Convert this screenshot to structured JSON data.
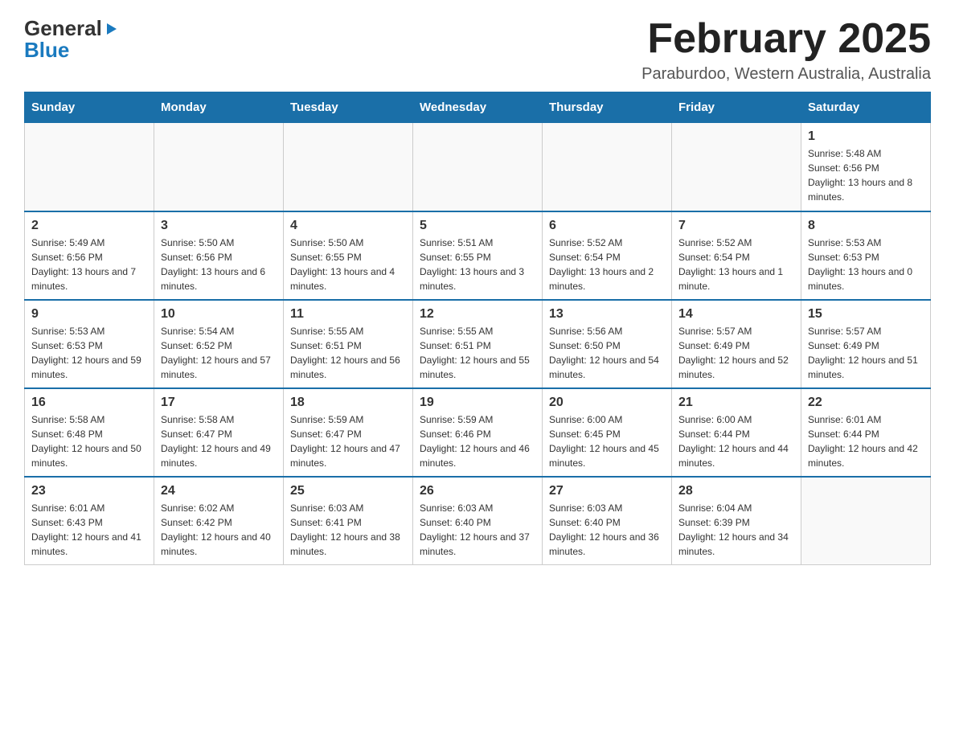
{
  "logo": {
    "line1": "General",
    "triangle": "▶",
    "line2": "Blue"
  },
  "title": "February 2025",
  "location": "Paraburdoo, Western Australia, Australia",
  "weekdays": [
    "Sunday",
    "Monday",
    "Tuesday",
    "Wednesday",
    "Thursday",
    "Friday",
    "Saturday"
  ],
  "weeks": [
    [
      null,
      null,
      null,
      null,
      null,
      null,
      {
        "day": "1",
        "sunrise": "Sunrise: 5:48 AM",
        "sunset": "Sunset: 6:56 PM",
        "daylight": "Daylight: 13 hours and 8 minutes."
      }
    ],
    [
      {
        "day": "2",
        "sunrise": "Sunrise: 5:49 AM",
        "sunset": "Sunset: 6:56 PM",
        "daylight": "Daylight: 13 hours and 7 minutes."
      },
      {
        "day": "3",
        "sunrise": "Sunrise: 5:50 AM",
        "sunset": "Sunset: 6:56 PM",
        "daylight": "Daylight: 13 hours and 6 minutes."
      },
      {
        "day": "4",
        "sunrise": "Sunrise: 5:50 AM",
        "sunset": "Sunset: 6:55 PM",
        "daylight": "Daylight: 13 hours and 4 minutes."
      },
      {
        "day": "5",
        "sunrise": "Sunrise: 5:51 AM",
        "sunset": "Sunset: 6:55 PM",
        "daylight": "Daylight: 13 hours and 3 minutes."
      },
      {
        "day": "6",
        "sunrise": "Sunrise: 5:52 AM",
        "sunset": "Sunset: 6:54 PM",
        "daylight": "Daylight: 13 hours and 2 minutes."
      },
      {
        "day": "7",
        "sunrise": "Sunrise: 5:52 AM",
        "sunset": "Sunset: 6:54 PM",
        "daylight": "Daylight: 13 hours and 1 minute."
      },
      {
        "day": "8",
        "sunrise": "Sunrise: 5:53 AM",
        "sunset": "Sunset: 6:53 PM",
        "daylight": "Daylight: 13 hours and 0 minutes."
      }
    ],
    [
      {
        "day": "9",
        "sunrise": "Sunrise: 5:53 AM",
        "sunset": "Sunset: 6:53 PM",
        "daylight": "Daylight: 12 hours and 59 minutes."
      },
      {
        "day": "10",
        "sunrise": "Sunrise: 5:54 AM",
        "sunset": "Sunset: 6:52 PM",
        "daylight": "Daylight: 12 hours and 57 minutes."
      },
      {
        "day": "11",
        "sunrise": "Sunrise: 5:55 AM",
        "sunset": "Sunset: 6:51 PM",
        "daylight": "Daylight: 12 hours and 56 minutes."
      },
      {
        "day": "12",
        "sunrise": "Sunrise: 5:55 AM",
        "sunset": "Sunset: 6:51 PM",
        "daylight": "Daylight: 12 hours and 55 minutes."
      },
      {
        "day": "13",
        "sunrise": "Sunrise: 5:56 AM",
        "sunset": "Sunset: 6:50 PM",
        "daylight": "Daylight: 12 hours and 54 minutes."
      },
      {
        "day": "14",
        "sunrise": "Sunrise: 5:57 AM",
        "sunset": "Sunset: 6:49 PM",
        "daylight": "Daylight: 12 hours and 52 minutes."
      },
      {
        "day": "15",
        "sunrise": "Sunrise: 5:57 AM",
        "sunset": "Sunset: 6:49 PM",
        "daylight": "Daylight: 12 hours and 51 minutes."
      }
    ],
    [
      {
        "day": "16",
        "sunrise": "Sunrise: 5:58 AM",
        "sunset": "Sunset: 6:48 PM",
        "daylight": "Daylight: 12 hours and 50 minutes."
      },
      {
        "day": "17",
        "sunrise": "Sunrise: 5:58 AM",
        "sunset": "Sunset: 6:47 PM",
        "daylight": "Daylight: 12 hours and 49 minutes."
      },
      {
        "day": "18",
        "sunrise": "Sunrise: 5:59 AM",
        "sunset": "Sunset: 6:47 PM",
        "daylight": "Daylight: 12 hours and 47 minutes."
      },
      {
        "day": "19",
        "sunrise": "Sunrise: 5:59 AM",
        "sunset": "Sunset: 6:46 PM",
        "daylight": "Daylight: 12 hours and 46 minutes."
      },
      {
        "day": "20",
        "sunrise": "Sunrise: 6:00 AM",
        "sunset": "Sunset: 6:45 PM",
        "daylight": "Daylight: 12 hours and 45 minutes."
      },
      {
        "day": "21",
        "sunrise": "Sunrise: 6:00 AM",
        "sunset": "Sunset: 6:44 PM",
        "daylight": "Daylight: 12 hours and 44 minutes."
      },
      {
        "day": "22",
        "sunrise": "Sunrise: 6:01 AM",
        "sunset": "Sunset: 6:44 PM",
        "daylight": "Daylight: 12 hours and 42 minutes."
      }
    ],
    [
      {
        "day": "23",
        "sunrise": "Sunrise: 6:01 AM",
        "sunset": "Sunset: 6:43 PM",
        "daylight": "Daylight: 12 hours and 41 minutes."
      },
      {
        "day": "24",
        "sunrise": "Sunrise: 6:02 AM",
        "sunset": "Sunset: 6:42 PM",
        "daylight": "Daylight: 12 hours and 40 minutes."
      },
      {
        "day": "25",
        "sunrise": "Sunrise: 6:03 AM",
        "sunset": "Sunset: 6:41 PM",
        "daylight": "Daylight: 12 hours and 38 minutes."
      },
      {
        "day": "26",
        "sunrise": "Sunrise: 6:03 AM",
        "sunset": "Sunset: 6:40 PM",
        "daylight": "Daylight: 12 hours and 37 minutes."
      },
      {
        "day": "27",
        "sunrise": "Sunrise: 6:03 AM",
        "sunset": "Sunset: 6:40 PM",
        "daylight": "Daylight: 12 hours and 36 minutes."
      },
      {
        "day": "28",
        "sunrise": "Sunrise: 6:04 AM",
        "sunset": "Sunset: 6:39 PM",
        "daylight": "Daylight: 12 hours and 34 minutes."
      },
      null
    ]
  ]
}
